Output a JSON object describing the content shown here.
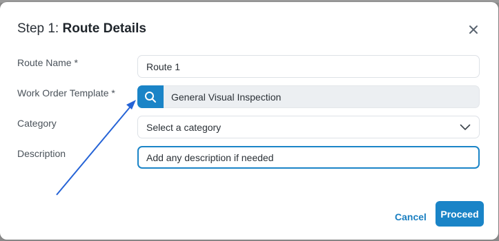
{
  "dialog": {
    "title_prefix": "Step 1: ",
    "title_main": "Route Details"
  },
  "form": {
    "route_name": {
      "label": "Route Name *",
      "value": "Route 1"
    },
    "work_order_template": {
      "label": "Work Order Template *",
      "value": "General Visual Inspection"
    },
    "category": {
      "label": "Category",
      "placeholder": "Select a category"
    },
    "description": {
      "label": "Description",
      "placeholder": "Add any description if needed"
    }
  },
  "actions": {
    "cancel": "Cancel",
    "proceed": "Proceed"
  },
  "icons": {
    "close": "close-icon",
    "search": "search-icon",
    "dropdown": "chevron-down-icon"
  },
  "colors": {
    "accent": "#1a84c7",
    "annotation_arrow": "#2563d6"
  }
}
